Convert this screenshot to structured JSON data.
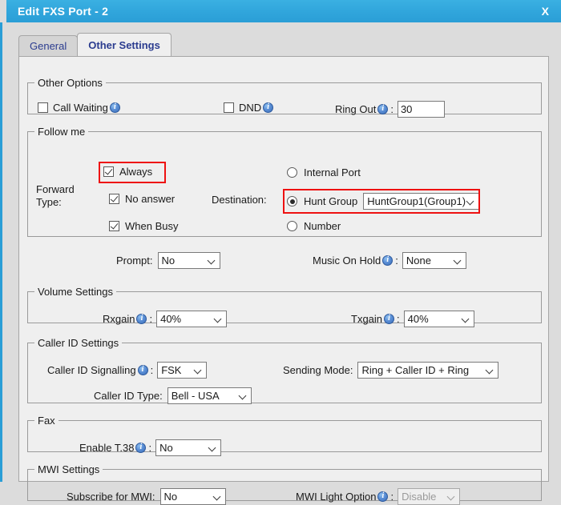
{
  "window": {
    "title": "Edit FXS Port - 2",
    "close_label": "X",
    "accent_color": "#2a9ed6"
  },
  "tabs": [
    {
      "label": "General",
      "active": false
    },
    {
      "label": "Other Settings",
      "active": true
    }
  ],
  "groups": {
    "other_options": {
      "legend": "Other Options",
      "call_waiting": {
        "label": "Call Waiting",
        "checked": false,
        "info": "info-icon"
      },
      "dnd": {
        "label": "DND",
        "checked": false,
        "info": "info-icon"
      },
      "ring_out": {
        "label": "Ring Out",
        "separator": ":",
        "value": "30",
        "info": "info-icon"
      }
    },
    "follow_me": {
      "legend": "Follow me",
      "forward_type_label_line1": "Forward",
      "forward_type_label_line2": "Type:",
      "always": {
        "label": "Always",
        "checked": true,
        "highlighted": true
      },
      "no_answer": {
        "label": "No answer",
        "checked": true
      },
      "when_busy": {
        "label": "When Busy",
        "checked": true
      },
      "destination_label": "Destination:",
      "internal_port": {
        "label": "Internal Port",
        "selected": false
      },
      "hunt_group": {
        "label": "Hunt Group",
        "selected": true,
        "value": "HuntGroup1(Group1)",
        "highlighted": true
      },
      "number": {
        "label": "Number",
        "selected": false
      },
      "prompt": {
        "label": "Prompt:",
        "value": "No"
      },
      "music_on_hold": {
        "label": "Music On Hold",
        "separator": ":",
        "value": "None",
        "info": "info-icon"
      }
    },
    "volume_settings": {
      "legend": "Volume Settings",
      "rxgain": {
        "label": "Rxgain",
        "separator": ":",
        "value": "40%",
        "info": "info-icon"
      },
      "txgain": {
        "label": "Txgain",
        "separator": ":",
        "value": "40%",
        "info": "info-icon"
      }
    },
    "caller_id_settings": {
      "legend": "Caller ID Settings",
      "caller_id_signalling": {
        "label": "Caller ID Signalling",
        "separator": ":",
        "value": "FSK",
        "info": "info-icon"
      },
      "sending_mode": {
        "label": "Sending Mode:",
        "value": "Ring + Caller ID + Ring"
      },
      "caller_id_type": {
        "label": "Caller ID Type:",
        "value": "Bell - USA"
      }
    },
    "fax": {
      "legend": "Fax",
      "enable_t38": {
        "label": "Enable T.38",
        "separator": ":",
        "value": "No",
        "info": "info-icon"
      }
    },
    "mwi_settings": {
      "legend": "MWI Settings",
      "subscribe_for_mwi": {
        "label": "Subscribe for MWI:",
        "value": "No"
      },
      "mwi_light_option": {
        "label": "MWI Light Option",
        "separator": ":",
        "value": "Disable",
        "info": "info-icon",
        "disabled": true
      }
    }
  }
}
